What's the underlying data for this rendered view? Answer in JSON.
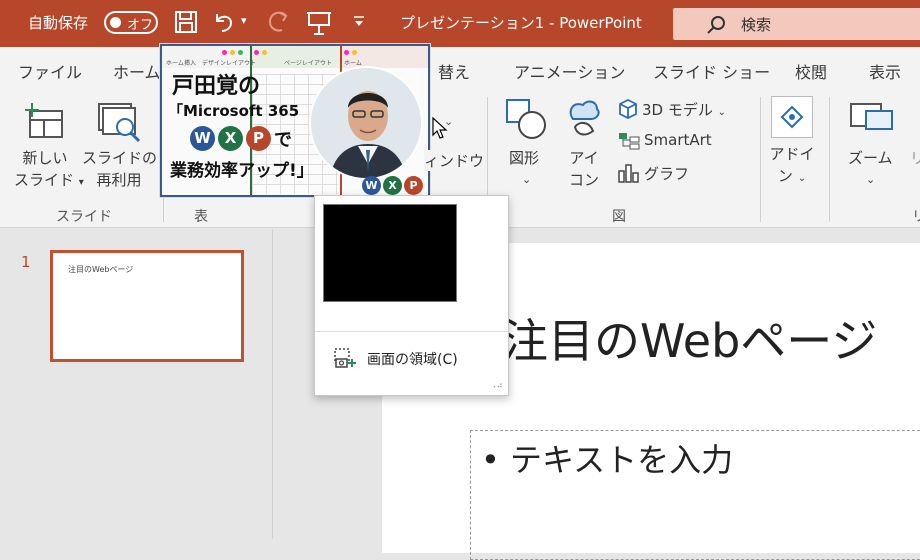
{
  "titlebar": {
    "autosave_label": "自動保存",
    "toggle_label": "オフ",
    "title": "プレゼンテーション1  -  PowerPoint",
    "search_label": "検索",
    "bg_color": "#b7472a"
  },
  "tabs": [
    "ファイル",
    "ホーム",
    "替え",
    "アニメーション",
    "スライド ショー",
    "校閲",
    "表示"
  ],
  "ribbon": {
    "new_slide": [
      "新しい",
      "スライド"
    ],
    "reuse_slide": [
      "スライドの",
      "再利用"
    ],
    "group_slide": "スライド",
    "group_table": "表",
    "shapes": "図形",
    "icons": [
      "アイ",
      "コン"
    ],
    "model3d": "3D モデル",
    "smartart": "SmartArt",
    "chart": "グラフ",
    "group_illustrations": "図",
    "addins": [
      "アドイ",
      "ン"
    ],
    "zoom": "ズーム",
    "partial_r": "リ",
    "partial_group": "リ",
    "window_partial": "ィンドウ"
  },
  "book": {
    "title": "戸田覚の",
    "subtitle": "「Microsoft 365",
    "badges": [
      "W",
      "X",
      "P"
    ],
    "de": "で",
    "tagline": "業務効率アップ!」",
    "mini_tabs": [
      "ホーム",
      "挿入",
      "デザイン",
      "レイアウト"
    ],
    "mini_tabs2": [
      "ページ",
      "レイアウト"
    ],
    "badge_colors": [
      "#2b579a",
      "#217346",
      "#b7472a"
    ]
  },
  "slides_pane": {
    "number": "1",
    "thumb_title": "注目のWebページ"
  },
  "slide": {
    "title": "注目のWebページ",
    "body": "• テキストを入力"
  },
  "dropdown": {
    "item_label": "画面の領域(C)"
  }
}
